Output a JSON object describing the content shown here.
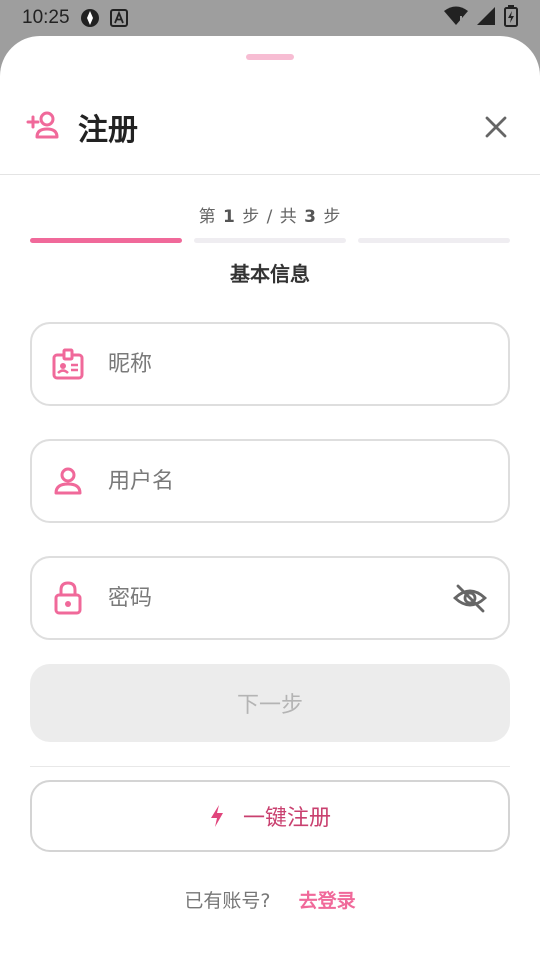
{
  "status_bar": {
    "time": "10:25"
  },
  "header": {
    "title": "注册"
  },
  "steps": {
    "label_prefix": "第",
    "current": "1",
    "label_middle": "步 / 共",
    "total": "3",
    "label_suffix": "步",
    "progress_fraction": 0.333,
    "step_title": "基本信息"
  },
  "form": {
    "nickname_placeholder": "昵称",
    "username_placeholder": "用户名",
    "password_placeholder": "密码",
    "next_label": "下一步",
    "quick_register_label": "一键注册"
  },
  "footer": {
    "have_account": "已有账号?",
    "login_link": "去登录"
  },
  "colors": {
    "accent": "#f0699a",
    "accent_dark": "#c9406f",
    "disabled_bg": "#ececec",
    "disabled_text": "#b4b4b4"
  },
  "icons": {
    "header": "add-user-icon",
    "close": "close-icon",
    "nickname": "id-badge-icon",
    "username": "person-icon",
    "password": "lock-icon",
    "toggle_password": "eye-off-icon",
    "quick_register": "bolt-icon"
  }
}
